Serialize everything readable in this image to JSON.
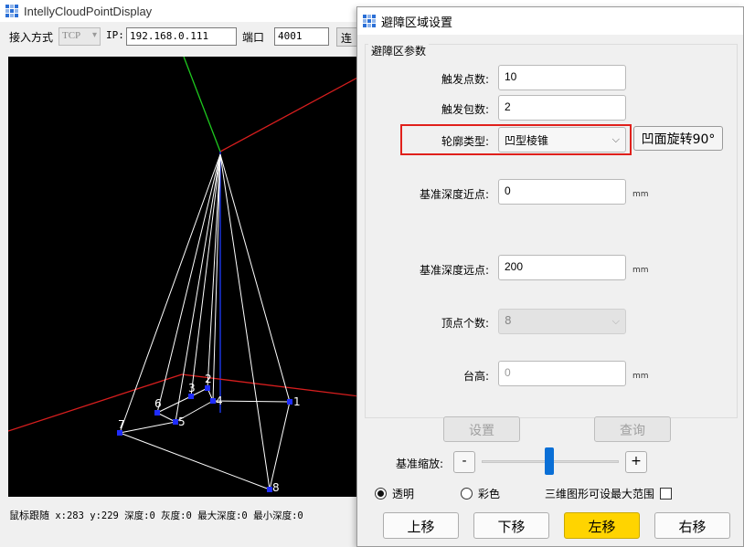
{
  "main_window": {
    "title": "IntellyCloudPointDisplay",
    "connection": {
      "mode_label": "接入方式",
      "mode_value": "TCP",
      "ip_label": "IP:",
      "ip_value": "192.168.0.111",
      "port_label": "端口",
      "port_value": "4001",
      "connect_label": "连"
    },
    "status": {
      "label": "鼠标跟随",
      "readout": "x:283 y:229 深度:0 灰度:0 最大深度:0 最小深度:0"
    },
    "vertex_labels": [
      "1",
      "2",
      "3",
      "4",
      "5",
      "6",
      "7",
      "8"
    ],
    "colors": {
      "x_axis": "#d81e1e",
      "y_axis": "#1ec81e",
      "z_axis": "#1e3cff",
      "wire": "#ffffff",
      "vertex": "#1e2cff"
    }
  },
  "dialog": {
    "title": "避障区域设置",
    "group_title": "避障区参数",
    "trigger_points": {
      "label": "触发点数:",
      "value": "10"
    },
    "trigger_packets": {
      "label": "触发包数:",
      "value": "2"
    },
    "contour_type": {
      "label": "轮廓类型:",
      "value": "凹型棱锥"
    },
    "rotate_button": "凹面旋转90°",
    "near_depth": {
      "label": "基准深度近点:",
      "value": "0",
      "unit": "mm"
    },
    "far_depth": {
      "label": "基准深度远点:",
      "value": "200",
      "unit": "mm"
    },
    "vertex_count": {
      "label": "顶点个数:",
      "value": "8"
    },
    "platform_height": {
      "label": "台高:",
      "value": "0",
      "unit": "mm"
    },
    "set_button": "设置",
    "query_button": "查询",
    "scale": {
      "label": "基准缩放:",
      "minus": "-",
      "plus": "+",
      "level": 0.5
    },
    "transparent": {
      "label": "透明",
      "checked": true
    },
    "colored": {
      "label": "彩色",
      "checked": false
    },
    "max_range": {
      "label": "三维图形可设最大范围",
      "checked": false
    },
    "move_buttons": {
      "up": "上移",
      "down": "下移",
      "left": "左移",
      "right": "右移"
    },
    "colors": {
      "highlight": "#e0201b",
      "active_button": "#ffd400",
      "slider": "#0a6fd6"
    }
  }
}
